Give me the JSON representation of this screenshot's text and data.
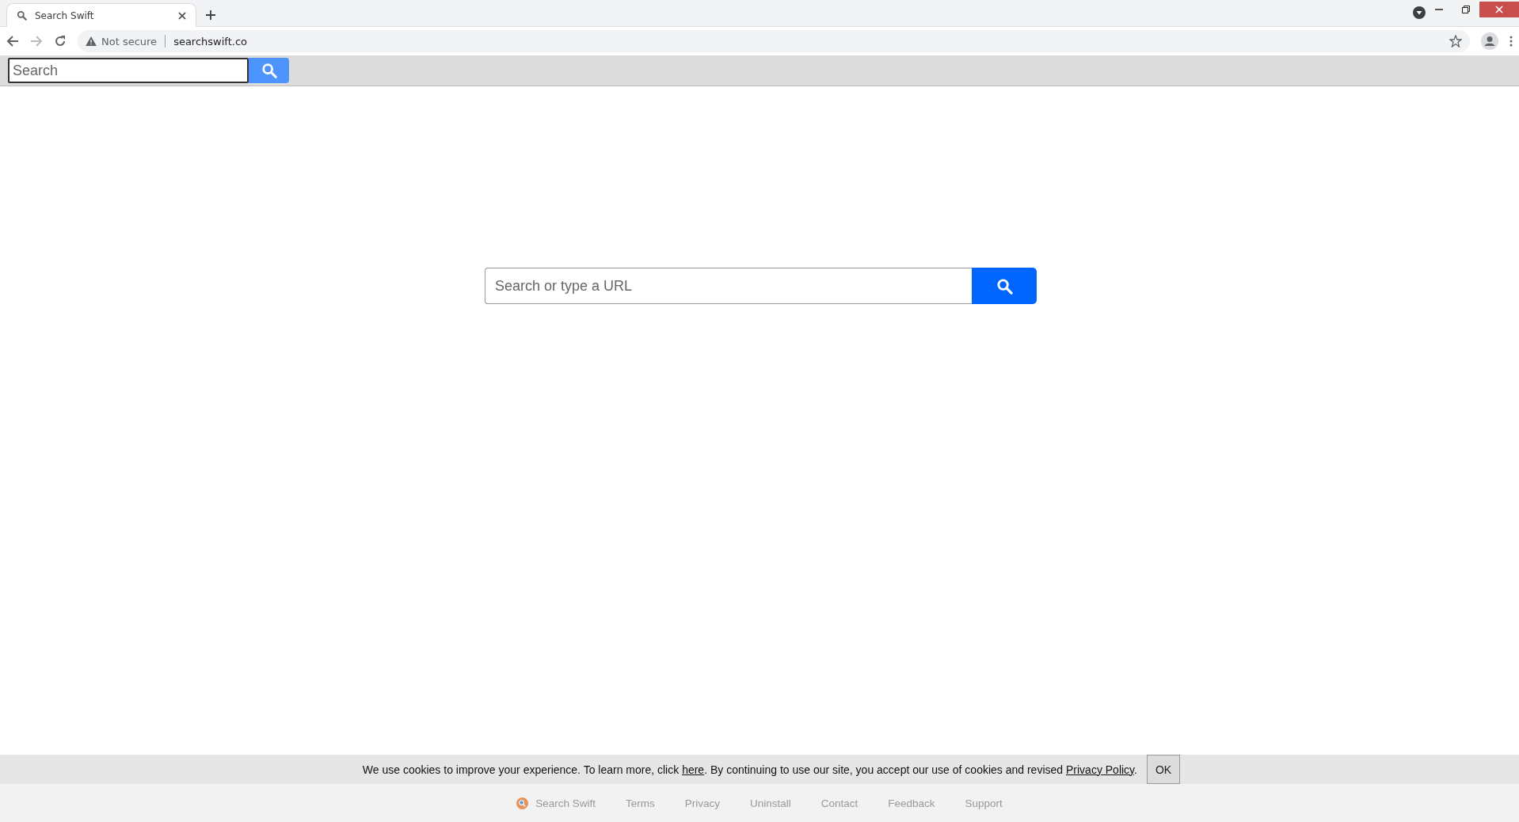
{
  "browser": {
    "tabs": [
      {
        "title": "Search Swift",
        "selected": true
      }
    ],
    "address": {
      "security": "Not secure",
      "url": "searchswift.co"
    }
  },
  "toolbar": {
    "search": {
      "placeholder": "Search"
    }
  },
  "main_search": {
    "placeholder": "Search or type a URL"
  },
  "cookie_notice": {
    "parts": [
      {
        "kind": "text",
        "text": "We use cookies to improve your experience. To learn more, click "
      },
      {
        "kind": "link",
        "text": "here"
      },
      {
        "kind": "text",
        "text": ". By continuing to use our site, you accept our use of cookies and revised "
      },
      {
        "kind": "link",
        "text": "Privacy Policy"
      },
      {
        "kind": "text",
        "text": "."
      }
    ],
    "button": "OK"
  },
  "footer": {
    "brand": "Search Swift",
    "links": [
      "Terms",
      "Privacy",
      "Uninstall",
      "Contact",
      "Feedback",
      "Support"
    ]
  }
}
